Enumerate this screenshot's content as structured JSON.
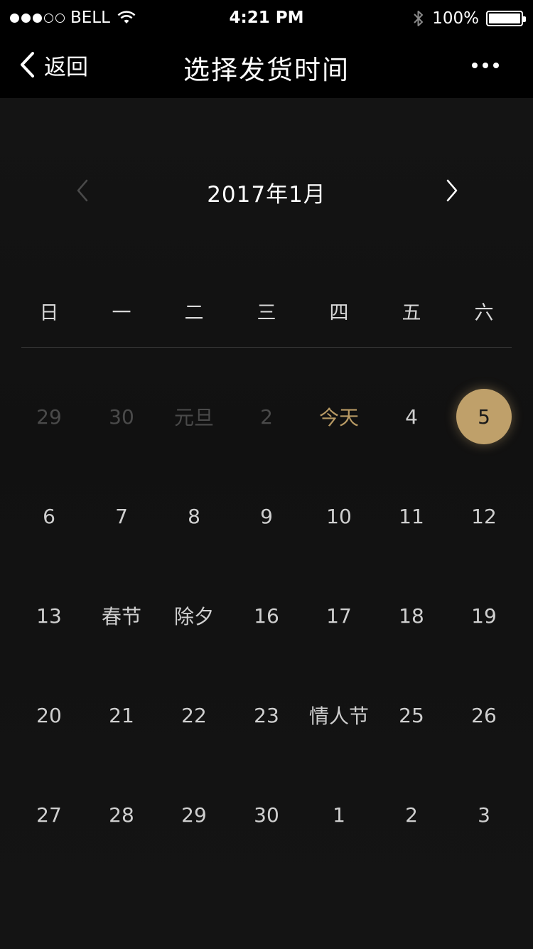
{
  "status_bar": {
    "carrier": "BELL",
    "time": "4:21 PM",
    "battery": "100%",
    "battery_level": 1.0,
    "signal_bars": 3,
    "signal_total": 5
  },
  "nav": {
    "back_label": "返回",
    "title": "选择发货时间",
    "more_icon": "more-dots-icon"
  },
  "calendar": {
    "month_label": "2017年1月",
    "weekdays": [
      "日",
      "一",
      "二",
      "三",
      "四",
      "五",
      "六"
    ],
    "accent_color": "#bfa06a",
    "weeks": [
      [
        {
          "label": "29",
          "state": "muted"
        },
        {
          "label": "30",
          "state": "muted"
        },
        {
          "label": "元旦",
          "state": "muted"
        },
        {
          "label": "2",
          "state": "muted"
        },
        {
          "label": "今天",
          "state": "today"
        },
        {
          "label": "4",
          "state": "normal"
        },
        {
          "label": "5",
          "state": "selected"
        }
      ],
      [
        {
          "label": "6",
          "state": "normal"
        },
        {
          "label": "7",
          "state": "normal"
        },
        {
          "label": "8",
          "state": "normal"
        },
        {
          "label": "9",
          "state": "normal"
        },
        {
          "label": "10",
          "state": "normal"
        },
        {
          "label": "11",
          "state": "normal"
        },
        {
          "label": "12",
          "state": "normal"
        }
      ],
      [
        {
          "label": "13",
          "state": "normal"
        },
        {
          "label": "春节",
          "state": "normal"
        },
        {
          "label": "除夕",
          "state": "normal"
        },
        {
          "label": "16",
          "state": "normal"
        },
        {
          "label": "17",
          "state": "normal"
        },
        {
          "label": "18",
          "state": "normal"
        },
        {
          "label": "19",
          "state": "normal"
        }
      ],
      [
        {
          "label": "20",
          "state": "normal"
        },
        {
          "label": "21",
          "state": "normal"
        },
        {
          "label": "22",
          "state": "normal"
        },
        {
          "label": "23",
          "state": "normal"
        },
        {
          "label": "情人节",
          "state": "normal"
        },
        {
          "label": "25",
          "state": "normal"
        },
        {
          "label": "26",
          "state": "normal"
        }
      ],
      [
        {
          "label": "27",
          "state": "normal"
        },
        {
          "label": "28",
          "state": "normal"
        },
        {
          "label": "29",
          "state": "normal"
        },
        {
          "label": "30",
          "state": "normal"
        },
        {
          "label": "1",
          "state": "normal"
        },
        {
          "label": "2",
          "state": "normal"
        },
        {
          "label": "3",
          "state": "normal"
        }
      ]
    ]
  }
}
